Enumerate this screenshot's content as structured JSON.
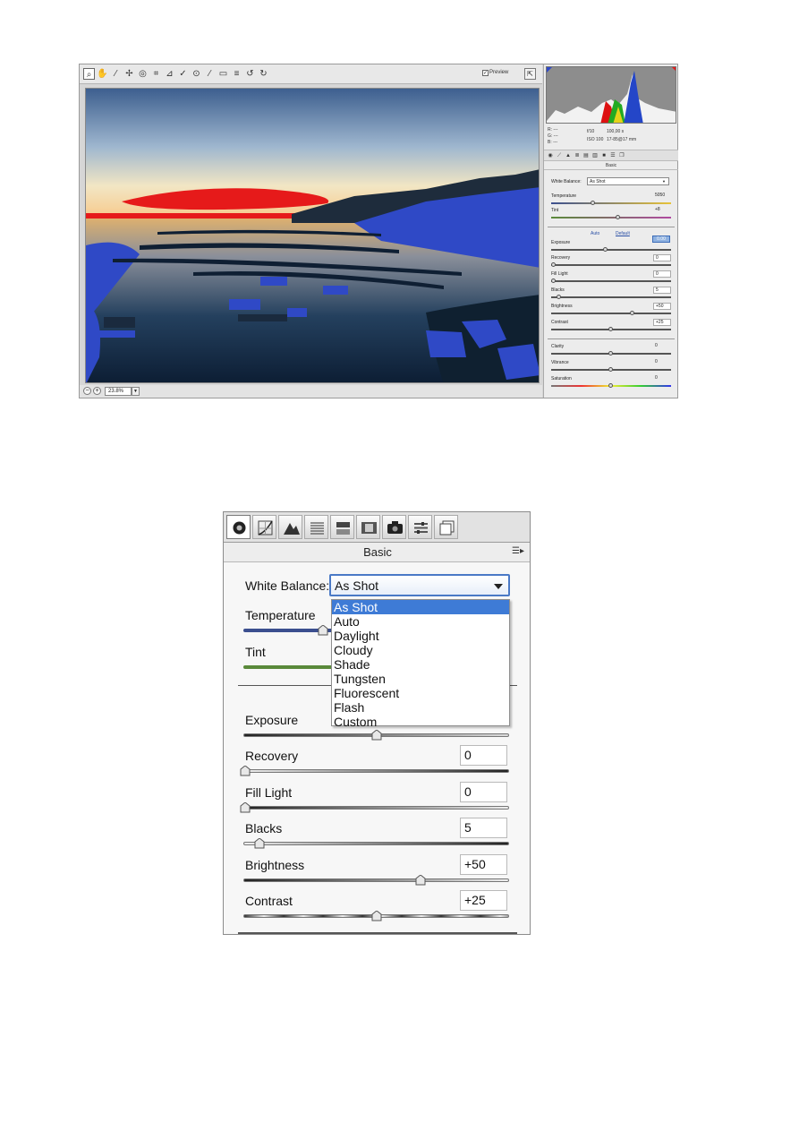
{
  "top_window": {
    "preview_label": "Preview",
    "zoom_value": "23.8%",
    "rgb": {
      "r": "R:  ---",
      "g": "G:  ---",
      "b": "B:  ---"
    },
    "exif": {
      "aperture": "f/10",
      "shutter": "100,00 s",
      "iso": "ISO 100",
      "lens": "17-85@17 mm"
    },
    "panel_title": "Basic",
    "white_balance_label": "White Balance:",
    "white_balance_value": "As Shot",
    "auto_label": "Auto",
    "default_label": "Default",
    "exposure_hilite": "0.00",
    "sliders": [
      {
        "label": "Temperature",
        "value": "5050"
      },
      {
        "label": "Tint",
        "value": "+8"
      },
      {
        "label": "Exposure",
        "value": ""
      },
      {
        "label": "Recovery",
        "value": "0"
      },
      {
        "label": "Fill Light",
        "value": "0"
      },
      {
        "label": "Blacks",
        "value": "5"
      },
      {
        "label": "Brightness",
        "value": "+50"
      },
      {
        "label": "Contrast",
        "value": "+25"
      },
      {
        "label": "Clarity",
        "value": "0"
      },
      {
        "label": "Vibrance",
        "value": "0"
      },
      {
        "label": "Saturation",
        "value": "0"
      }
    ]
  },
  "panel": {
    "title": "Basic",
    "menu_icon": "menu-icon",
    "tabs": [
      "basic-icon",
      "tone-curve-icon",
      "detail-icon",
      "hsl-icon",
      "split-toning-icon",
      "lens-corrections-icon",
      "camera-calibration-icon",
      "presets-icon",
      "snapshots-icon"
    ],
    "white_balance": {
      "label": "White Balance:",
      "selected": "As Shot",
      "options": [
        "As Shot",
        "Auto",
        "Daylight",
        "Cloudy",
        "Shade",
        "Tungsten",
        "Fluorescent",
        "Flash",
        "Custom"
      ]
    },
    "temperature_label": "Temperature",
    "tint_label": "Tint",
    "exposure_label": "Exposure",
    "recovery": {
      "label": "Recovery",
      "value": "0"
    },
    "fill_light": {
      "label": "Fill Light",
      "value": "0"
    },
    "blacks": {
      "label": "Blacks",
      "value": "5"
    },
    "brightness": {
      "label": "Brightness",
      "value": "+50"
    },
    "contrast": {
      "label": "Contrast",
      "value": "+25"
    }
  },
  "colors": {
    "accent_blue": "#3e7bd6",
    "temperature_track": "#3b4f8f",
    "tint_track": "#5a8a3a",
    "clipping_red": "#e61a1a",
    "clipping_blue": "#2f49c6"
  }
}
